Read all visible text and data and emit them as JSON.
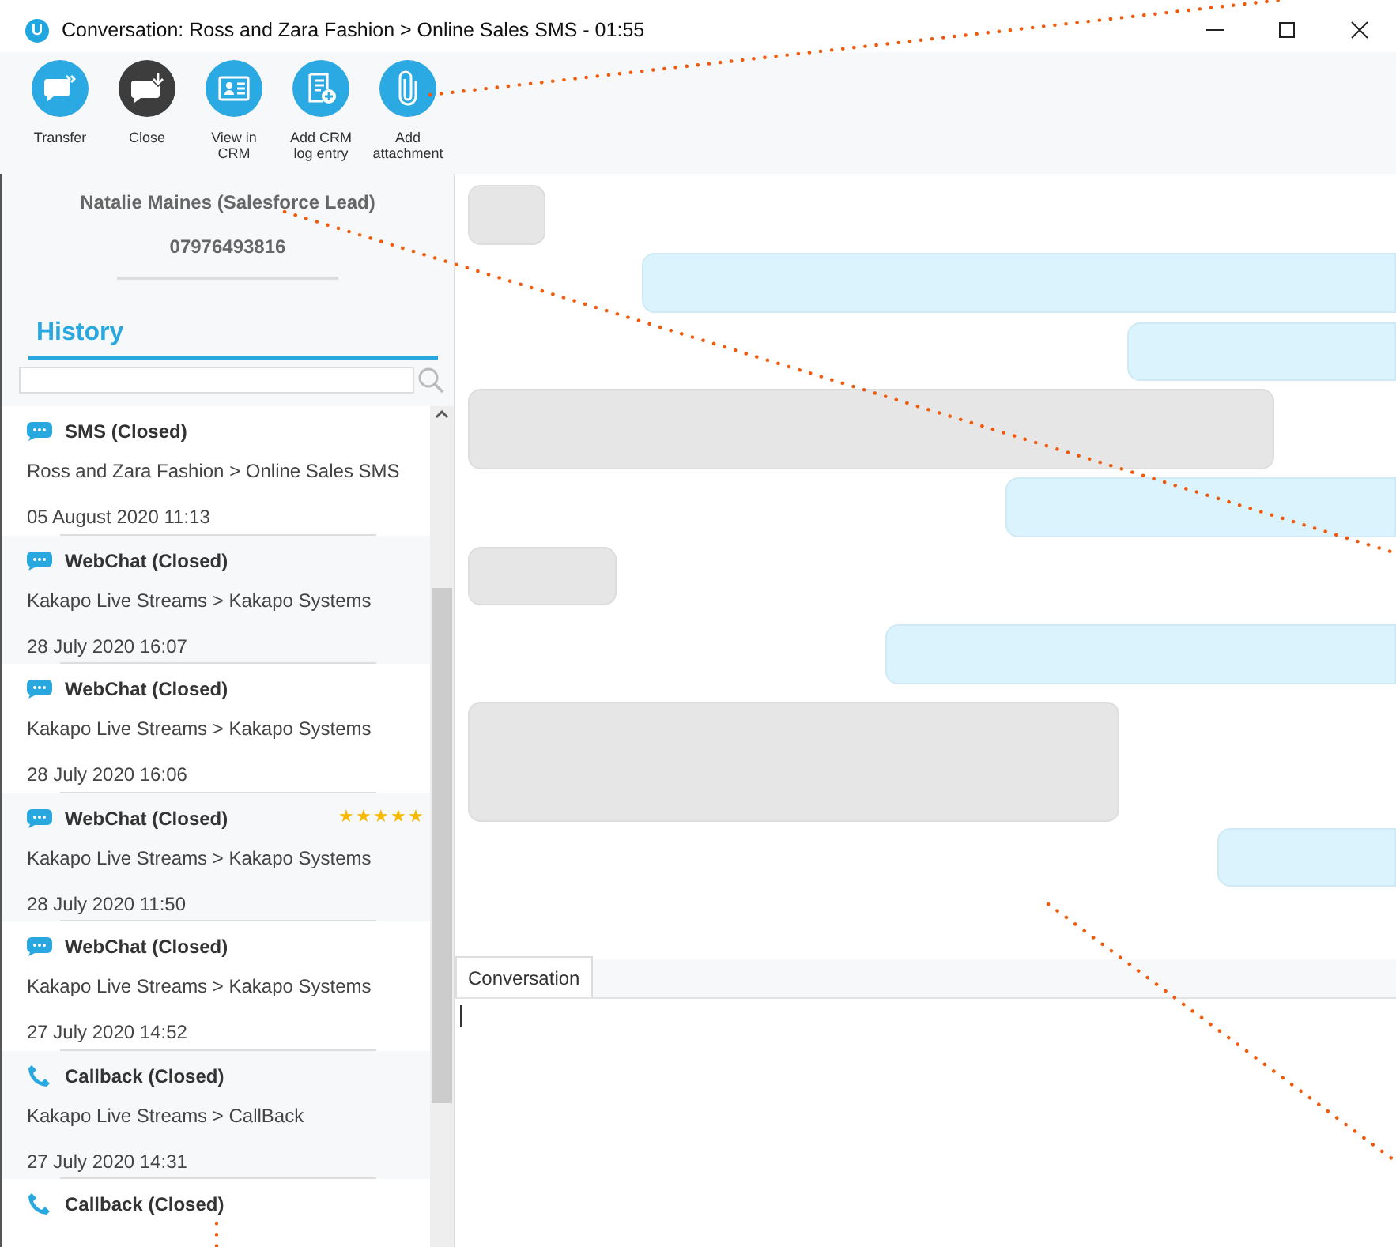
{
  "window": {
    "app_icon": "U",
    "title": "Conversation: Ross and Zara Fashion > Online Sales SMS - 01:55"
  },
  "toolbar": [
    {
      "kind": "transfer",
      "label": "Transfer"
    },
    {
      "kind": "close",
      "label": "Close"
    },
    {
      "kind": "crm",
      "label": "View in CRM"
    },
    {
      "kind": "log",
      "label": "Add CRM log entry"
    },
    {
      "kind": "attach",
      "label": "Add attachment"
    }
  ],
  "contact": {
    "name": "Natalie Maines (Salesforce Lead)",
    "phone": "07976493816"
  },
  "history": {
    "title": "History",
    "items": [
      {
        "kind": "chat",
        "title": "SMS (Closed)",
        "route": "Ross and Zara Fashion > Online Sales SMS",
        "date": "05 August 2020 11:13"
      },
      {
        "kind": "chat",
        "title": "WebChat (Closed)",
        "route": "Kakapo Live Streams > Kakapo Systems",
        "date": "28 July 2020 16:07"
      },
      {
        "kind": "chat",
        "title": "WebChat (Closed)",
        "route": "Kakapo Live Streams > Kakapo Systems",
        "date": "28 July 2020 16:06"
      },
      {
        "kind": "chat",
        "title": "WebChat (Closed)",
        "route": "Kakapo Live Streams > Kakapo Systems",
        "date": "28 July 2020 11:50",
        "stars": 5
      },
      {
        "kind": "chat",
        "title": "WebChat (Closed)",
        "route": "Kakapo Live Streams > Kakapo Systems",
        "date": "27 July 2020 14:52"
      },
      {
        "kind": "call",
        "title": "Callback (Closed)",
        "route": "Kakapo Live Streams > CallBack",
        "date": "27 July 2020 14:31"
      },
      {
        "kind": "call",
        "title": "Callback (Closed)"
      }
    ]
  },
  "messages": [
    {
      "kind": "received"
    },
    {
      "kind": "sent"
    },
    {
      "kind": "sent"
    },
    {
      "kind": "received"
    },
    {
      "kind": "sent"
    },
    {
      "kind": "received"
    },
    {
      "kind": "sent"
    },
    {
      "kind": "received"
    },
    {
      "kind": "sent"
    }
  ],
  "compose": {
    "tabs": [
      {
        "label": "Conversation",
        "selected": true
      }
    ]
  }
}
